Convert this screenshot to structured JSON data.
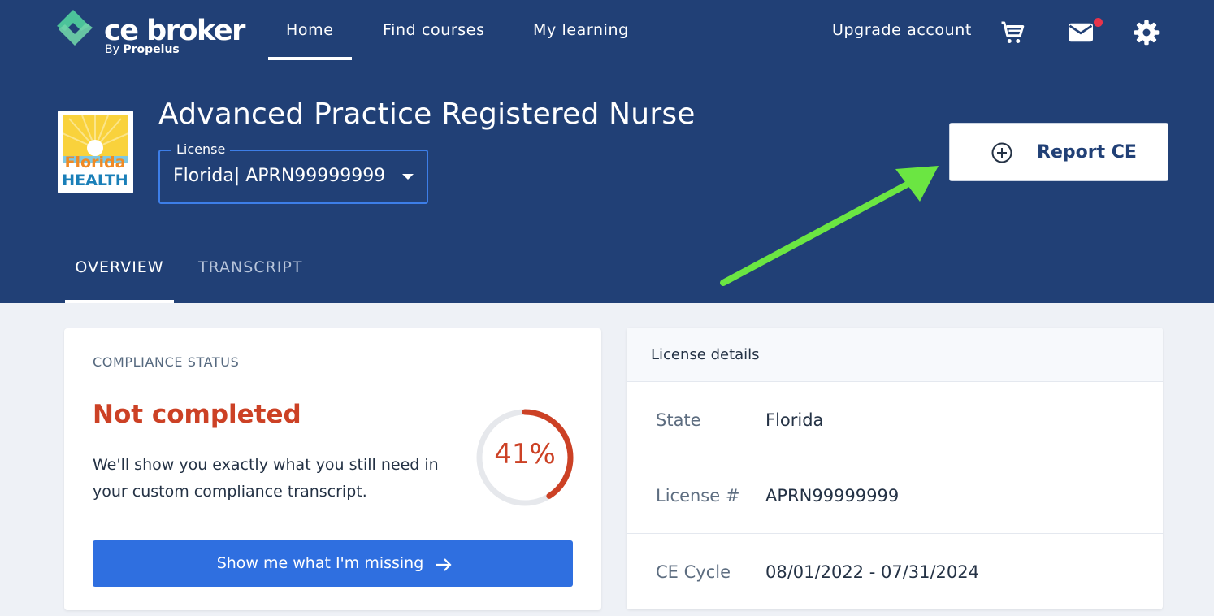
{
  "brand": {
    "name": "ce broker",
    "by_prefix": "By",
    "by_company": "Propelus"
  },
  "nav": {
    "items": [
      {
        "label": "Home",
        "active": true
      },
      {
        "label": "Find courses",
        "active": false
      },
      {
        "label": "My learning",
        "active": false
      }
    ],
    "upgrade_label": "Upgrade account",
    "icons": [
      "cart-icon",
      "mail-icon",
      "gear-icon"
    ]
  },
  "license_header": {
    "state_logo_top": "Florida",
    "state_logo_bottom": "HEALTH",
    "title": "Advanced Practice Registered Nurse",
    "license_label": "License",
    "license_value": "Florida| APRN99999999"
  },
  "report_button": {
    "label": "Report CE",
    "icon": "plus-circle-icon"
  },
  "tabs": [
    {
      "label": "OVERVIEW",
      "active": true
    },
    {
      "label": "TRANSCRIPT",
      "active": false
    }
  ],
  "compliance": {
    "label": "COMPLIANCE STATUS",
    "status": "Not completed",
    "description": "We'll show you exactly what you still need in your custom compliance transcript.",
    "percent": 41,
    "percent_label": "41%",
    "button_label": "Show me what I'm missing"
  },
  "license_details": {
    "title": "License details",
    "rows": [
      {
        "label": "State",
        "value": "Florida"
      },
      {
        "label": "License #",
        "value": "APRN99999999"
      },
      {
        "label": "CE Cycle",
        "value": "08/01/2022 - 07/31/2024"
      }
    ]
  },
  "colors": {
    "header_bg": "#214076",
    "primary_button": "#2f6fe0",
    "status_red": "#cc4125",
    "annotation_green": "#6be642",
    "notification": "#e8334a"
  }
}
